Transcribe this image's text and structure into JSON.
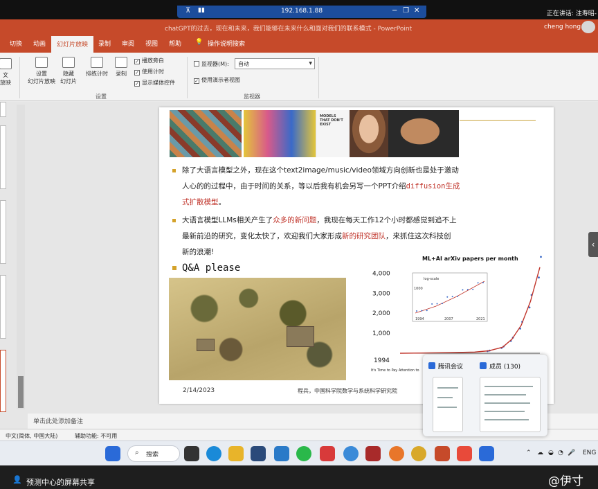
{
  "remote_bar": {
    "address": "192.168.1.88",
    "speaker": "正在讲话: 注寿昭-"
  },
  "app": {
    "doc_title": "chatGPT的过去，现在和未来，我们能够在未来什么和面对我们的联系模式  -  PowerPoint",
    "user": "cheng hong"
  },
  "tabs": [
    "切换",
    "动画",
    "幻灯片放映",
    "录制",
    "审阅",
    "视图",
    "帮助",
    "操作说明搜索"
  ],
  "active_tab": "幻灯片放映",
  "ribbon": {
    "btn_custom": "文",
    "btn_custom2": "放映",
    "btn_setup": "设置\n幻灯片放映",
    "btn_hide": "隐藏\n幻灯片",
    "btn_rehearse": "排练计时",
    "btn_record": "录制",
    "chk_narration": "播放旁白",
    "chk_timings": "使用计时",
    "chk_media": "显示媒体控件",
    "group_setup": "设置",
    "monitor_label": "监视器(M):",
    "monitor_value": "自动",
    "chk_presenter": "使用演示者视图",
    "group_monitors": "监视器"
  },
  "slide": {
    "image_caption": "MODELS\nTHAT DON'T\nEXIST",
    "bullet1_a": "除了大语言模型之外，现在这个text2image/music/video领域方向创新也是处于激动",
    "bullet1_b": "人心的的过程中，由于时间的关系，等以后我有机会另写一个PPT介绍",
    "bullet1_red": "diffusion生成",
    "bullet1_c_red": "式扩散模型",
    "bullet1_c": "。",
    "bullet2_a": "大语言模型LLMs相关产生了",
    "bullet2_red1": "众多的新问题",
    "bullet2_b": "，我现在每天工作12个小时都感觉到追不上",
    "bullet2_c": "最新前沿的研究，变化太快了，欢迎我们大家形成",
    "bullet2_red2": "新的研究团队",
    "bullet2_d": "，来抓住这次科技创",
    "bullet2_e": "新的浪潮!",
    "qa": "Q&A please",
    "date": "2/14/2023",
    "org": "程兵，中国科学院数学与系统科学研究院",
    "chart_caption": "It's Time to Pay Attention to"
  },
  "chart_data": {
    "type": "line",
    "title": "ML+AI arXiv papers per month",
    "x": [
      1994,
      2000,
      2005,
      2010,
      2013,
      2016,
      2018,
      2020,
      2022,
      2024
    ],
    "values": [
      0,
      15,
      30,
      60,
      120,
      300,
      700,
      1400,
      2600,
      4300
    ],
    "yticks": [
      1000,
      2000,
      3000,
      4000
    ],
    "ytick_labels": [
      "1,000",
      "2,000",
      "3,000",
      "4,000"
    ],
    "xticks": [
      "1994",
      "2024"
    ],
    "ylim": [
      0,
      4500
    ],
    "inset": {
      "label": "log-scale",
      "ylabel": "1000",
      "xticks": [
        "1994",
        "2007",
        "2021"
      ]
    },
    "line_color": "#c0342a",
    "point_color": "#3a6ac8"
  },
  "notes_placeholder": "单击此处添加备注",
  "status": {
    "language": "中文(简体, 中国大陆)",
    "accessibility": "辅助功能: 不可用"
  },
  "taskbar": {
    "search": "搜索",
    "lang": "ENG"
  },
  "popup": {
    "app1": "腾讯会议",
    "app2": "成员 (130)"
  },
  "bottom": {
    "sharing": "预测中心的屏幕共享",
    "watermark": "@伊寸"
  }
}
